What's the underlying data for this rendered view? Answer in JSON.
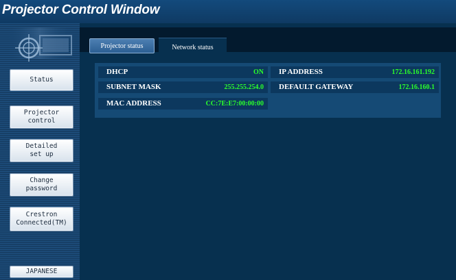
{
  "window": {
    "title": "Projector Control Window"
  },
  "sidebar": {
    "items": [
      {
        "label": "Status"
      },
      {
        "label": "Projector\ncontrol"
      },
      {
        "label": "Detailed\nset up"
      },
      {
        "label": "Change\npassword"
      },
      {
        "label": "Crestron\nConnected(TM)"
      },
      {
        "label": "JAPANESE"
      }
    ]
  },
  "tabs": [
    {
      "label": "Projector status",
      "active": false
    },
    {
      "label": "Network status",
      "active": true
    }
  ],
  "network": {
    "dhcp": {
      "label": "DHCP",
      "value": "ON"
    },
    "ip_address": {
      "label": "IP ADDRESS",
      "value": "172.16.161.192"
    },
    "subnet_mask": {
      "label": "SUBNET MASK",
      "value": "255.255.254.0"
    },
    "default_gateway": {
      "label": "DEFAULT GATEWAY",
      "value": "172.16.160.1"
    },
    "mac_address": {
      "label": "MAC ADDRESS",
      "value": "CC:7E:E7:00:00:00"
    }
  },
  "colors": {
    "value_text": "#2bff2b",
    "background": "#07304f",
    "sidebar": "#1b4a76"
  },
  "icons": {
    "logo": "projector-crosshair-logo-icon"
  }
}
